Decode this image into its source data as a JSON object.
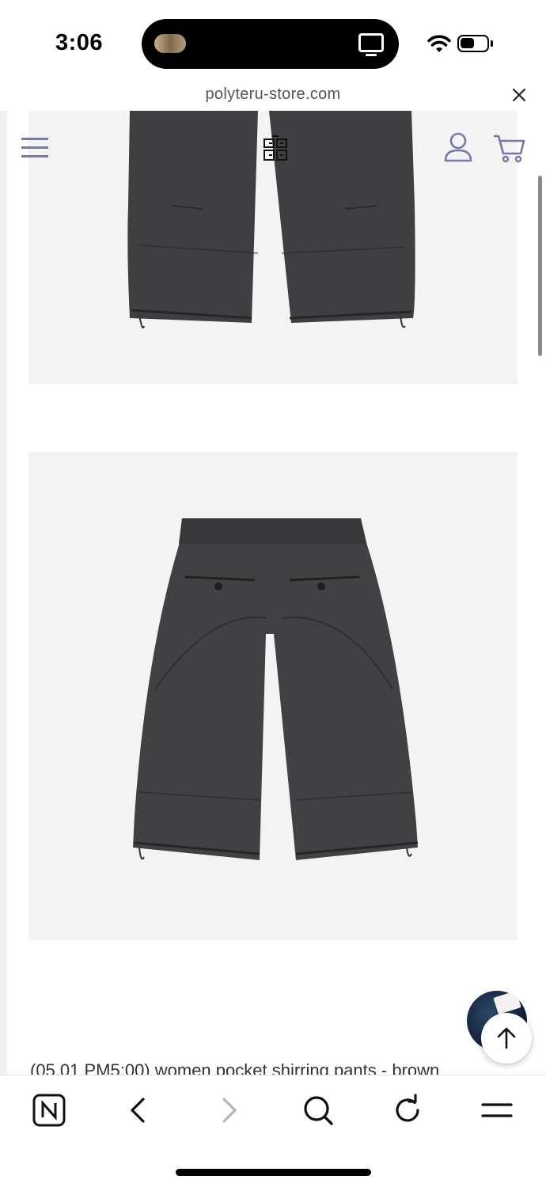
{
  "status_bar": {
    "time": "3:06",
    "battery_level": 0.55
  },
  "browser": {
    "url": "polyteru-store.com"
  },
  "product": {
    "caption": "(05.01 PM5:00) women pocket shirring pants - brown"
  },
  "icons": {
    "close": "close-icon",
    "menu": "hamburger-menu-icon",
    "logo": "store-logo",
    "user": "user-icon",
    "cart": "cart-icon",
    "scroll_top": "arrow-up-icon",
    "naver": "naver-n-icon",
    "back": "chevron-left-icon",
    "forward": "chevron-right-icon",
    "search": "search-icon",
    "reload": "reload-icon",
    "more": "menu-lines-icon"
  },
  "colors": {
    "accent": "#7779a7",
    "image_bg": "#f3f3f3",
    "pants": "#3f3f41"
  }
}
